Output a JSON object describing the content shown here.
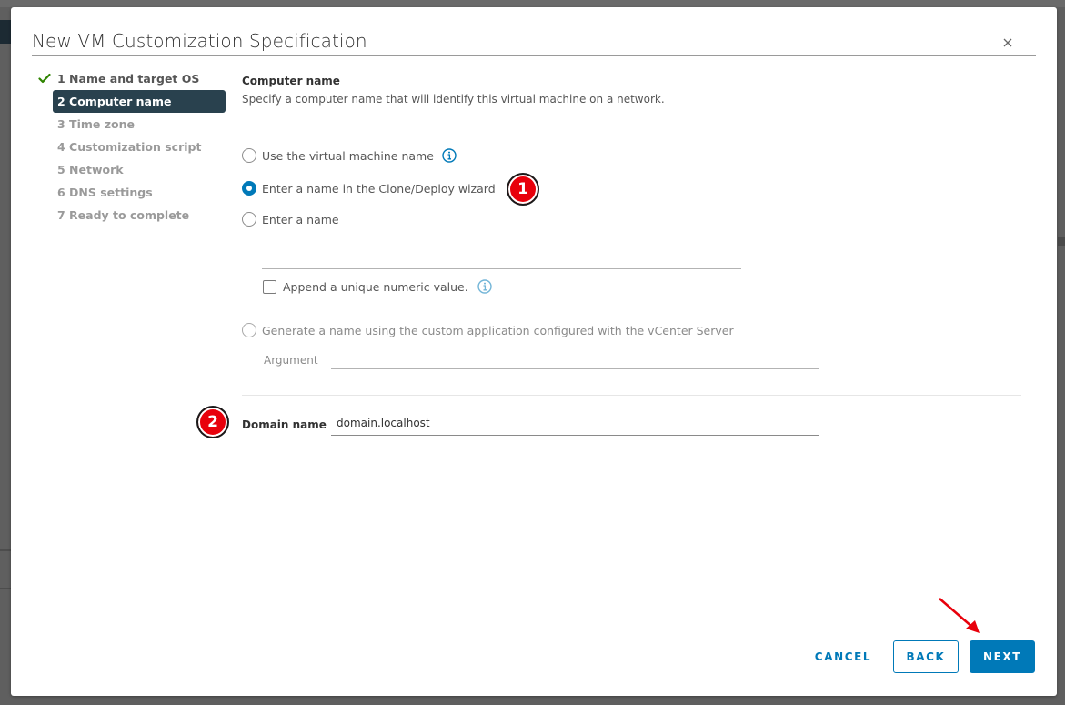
{
  "dialog": {
    "title": "New VM Customization Specification",
    "close_icon": "close-icon"
  },
  "steps": [
    {
      "label": "1 Name and target OS",
      "state": "completed",
      "icon": "check-icon"
    },
    {
      "label": "2 Computer name",
      "state": "active"
    },
    {
      "label": "3 Time zone",
      "state": "pending"
    },
    {
      "label": "4 Customization script",
      "state": "pending"
    },
    {
      "label": "5 Network",
      "state": "pending"
    },
    {
      "label": "6 DNS settings",
      "state": "pending"
    },
    {
      "label": "7 Ready to complete",
      "state": "pending"
    }
  ],
  "computer_name": {
    "title": "Computer name",
    "description": "Specify a computer name that will identify this virtual machine on a network.",
    "options": [
      {
        "label": "Use the virtual machine name",
        "checked": false,
        "has_info": true
      },
      {
        "label": "Enter a name in the Clone/Deploy wizard",
        "checked": true
      },
      {
        "label": "Enter a name",
        "checked": false
      },
      {
        "label": "Generate a name using the custom application configured with the vCenter Server",
        "checked": false
      }
    ],
    "enter_name_value": "",
    "append_numeric": {
      "label": "Append a unique numeric value.",
      "checked": false
    },
    "argument": {
      "label": "Argument",
      "value": ""
    }
  },
  "domain": {
    "label": "Domain name",
    "value": "domain.localhost"
  },
  "annotations": {
    "badge_1": "1",
    "badge_2": "2",
    "badge_color": "#e8000b",
    "arrow_color": "#e8000b"
  },
  "footer": {
    "cancel_label": "CANCEL",
    "back_label": "BACK",
    "next_label": "NEXT"
  },
  "colors": {
    "accent": "#0079b8",
    "active_step_bg": "#29414e",
    "check_green": "#2f8400"
  }
}
